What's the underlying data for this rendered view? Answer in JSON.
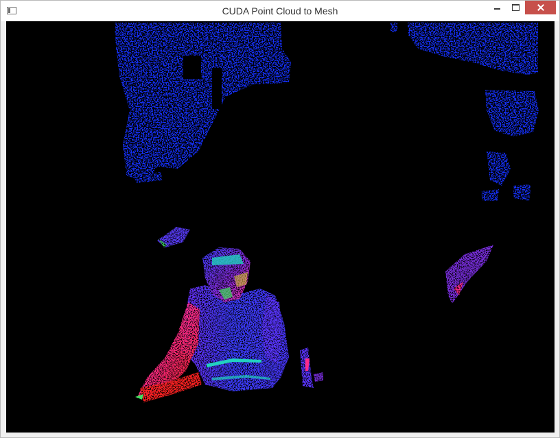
{
  "window": {
    "title": "CUDA Point Cloud to Mesh",
    "icon": "app-window-icon",
    "controls": [
      "minimize",
      "maximize",
      "close"
    ]
  },
  "viewport": {
    "content": "point-cloud-mesh-render",
    "background": "#000000",
    "colors": {
      "background_scene": "#1430ff",
      "person_blue": "#3a3cff",
      "person_purple": "#8a2ad8",
      "person_magenta": "#ff2a8a",
      "person_red": "#ff2020",
      "highlight_cyan": "#22d0c0",
      "highlight_green": "#40e060",
      "highlight_yellow": "#e0d030"
    }
  }
}
